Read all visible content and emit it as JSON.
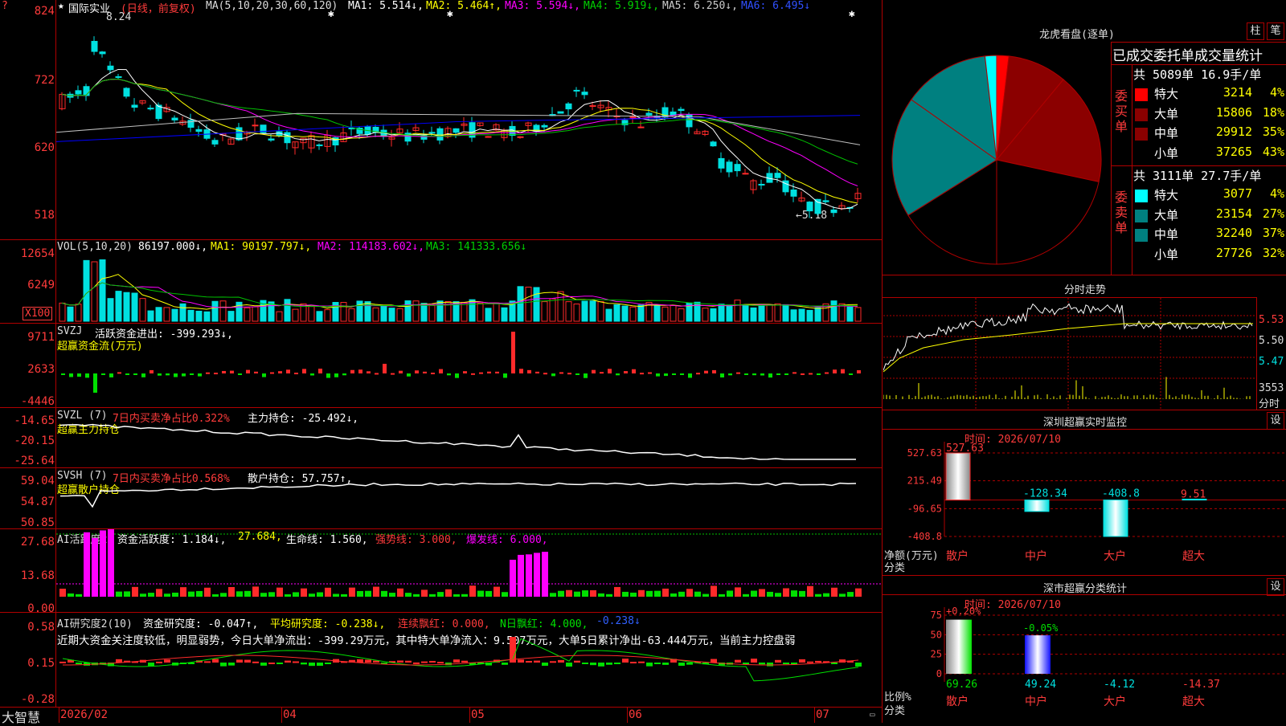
{
  "colors": {
    "up": "#ff2a2a",
    "down": "#00e0e0",
    "ma1": "#ffffff",
    "ma2": "#ffff00",
    "ma3": "#ff00ff",
    "ma4": "#00c000",
    "ma5": "#c0c0c0",
    "ma6": "#0000ff",
    "grid": "#b00000"
  },
  "kline": {
    "marker": "?",
    "star": "★",
    "name": "国际实业",
    "period": "(日线，前复权)",
    "ma_title": "MA(5,10,20,30,60,120)",
    "ma1": "MA1: 5.514↓,",
    "ma2": "MA2: 5.464↑,",
    "ma3": "MA3: 5.594↓,",
    "ma4": "MA4: 5.919↓,",
    "ma5": "MA5: 6.250↓,",
    "ma6": "MA6: 6.495↓",
    "y_ticks": [
      "824",
      "722",
      "620",
      "518"
    ],
    "high_label": "8.24",
    "low_label": "←5.18",
    "corner_mark": "✱"
  },
  "vol": {
    "title": "VOL(5,10,20)",
    "value": "86197.000↓,",
    "ma1": "MA1: 90197.797↓,",
    "ma2": "MA2: 114183.602↓,",
    "ma3": "MA3: 141333.656↓",
    "y_ticks": [
      "12654",
      "6249"
    ],
    "unit": "X100"
  },
  "svzj": {
    "title": "SVZJ",
    "name": "活跃资金进出: -399.293↓,",
    "sub": "超赢资金流(万元)",
    "y_ticks": [
      "9711",
      "2633",
      "-4446"
    ]
  },
  "svzl": {
    "title": "SVZL (7)",
    "ratio": "7日内买卖净占比0.322%",
    "hold": "主力持仓: -25.492↓,",
    "sub": "超赢主力持仓",
    "y_ticks": [
      "-14.65",
      "-20.15",
      "-25.64"
    ]
  },
  "svsh": {
    "title": "SVSH (7)",
    "ratio": "7日内买卖净占比0.568%",
    "hold": "散户持仓: 57.757↑,",
    "sub": "超赢散户持仓",
    "y_ticks": [
      "59.04",
      "54.87",
      "50.85"
    ]
  },
  "ai1": {
    "title": "AI活跃度2",
    "active": "资金活跃度: 1.184↓,",
    "val2": "27.684,",
    "life": "生命线: 1.560,",
    "strong": "强势线: 3.000,",
    "burst": "爆发线: 6.000,",
    "y_ticks": [
      "27.68",
      "13.68",
      "0.00"
    ]
  },
  "ai2": {
    "title": "AI研究度2(10)",
    "research": "资金研究度: -0.047↑,",
    "avg": "平均研究度: -0.238↓,",
    "cont": "连续飘红: 0.000,",
    "nday": "N日飘红: 4.000,",
    "neg": "-0.238↓",
    "comment": "近期大资金关注度较低，明显弱势，今日大单净流出：-399.29万元，其中特大单净流入：9.507万元，大单5日累计净出-63.444万元，当前主力控盘弱",
    "y_ticks": [
      "0.58",
      "0.15",
      "-0.28"
    ]
  },
  "xaxis": {
    "labels": [
      "2026/02",
      "04",
      "05",
      "06",
      "07"
    ]
  },
  "logo": "大智慧",
  "longhu": {
    "title": "龙虎看盘(逐单)",
    "btn1": "柱",
    "btn2": "笔",
    "header": "已成交委托单成交量统计",
    "buy_label": "委买单",
    "buy_total": "共 5089单 16.9手/单",
    "buy_rows": [
      {
        "name": "特大",
        "vol": "3214",
        "pct": "4%",
        "color": "#ff0000"
      },
      {
        "name": "大单",
        "vol": "15806",
        "pct": "18%",
        "color": "#8b0000"
      },
      {
        "name": "中单",
        "vol": "29912",
        "pct": "35%",
        "color": "#8b0000"
      },
      {
        "name": "小单",
        "vol": "37265",
        "pct": "43%",
        "color": "#000000"
      }
    ],
    "sell_label": "委卖单",
    "sell_total": "共 3111单 27.7手/单",
    "sell_rows": [
      {
        "name": "特大",
        "vol": "3077",
        "pct": "4%",
        "color": "#00ffff"
      },
      {
        "name": "大单",
        "vol": "23154",
        "pct": "27%",
        "color": "#008080"
      },
      {
        "name": "中单",
        "vol": "32240",
        "pct": "37%",
        "color": "#008080"
      },
      {
        "name": "小单",
        "vol": "27726",
        "pct": "32%",
        "color": "#000000"
      }
    ]
  },
  "fenshi": {
    "title": "分时走势",
    "prices": [
      "5.53",
      "5.50",
      "5.47"
    ],
    "vol": "3553",
    "vol_unit": "分时"
  },
  "sz_monitor": {
    "title": "深圳超赢实时监控",
    "btn": "设",
    "time": "时间: 2026/07/10",
    "y_ticks": [
      "527.63",
      "215.49",
      "-96.65",
      "-408.8"
    ],
    "ylabel": "净额(万元)",
    "xlabel": "分类",
    "bars": [
      {
        "name": "散户",
        "value": 527.63,
        "label": "527.63"
      },
      {
        "name": "中户",
        "value": -128.34,
        "label": "-128.34"
      },
      {
        "name": "大户",
        "value": -408.8,
        "label": "-408.8"
      },
      {
        "name": "超大",
        "value": 9.51,
        "label": "9.51"
      }
    ]
  },
  "sz_class": {
    "title": "深市超赢分类统计",
    "btn": "设",
    "time": "时间: 2026/07/10",
    "y_ticks": [
      "75",
      "50",
      "25",
      "0"
    ],
    "ylabel": "比例%",
    "xlabel": "分类",
    "top_labels": [
      "+0.20%",
      "-0.05%"
    ],
    "bars": [
      {
        "name": "散户",
        "value": 69.26,
        "label": "69.26"
      },
      {
        "name": "中户",
        "value": 49.24,
        "label": "49.24"
      },
      {
        "name": "大户",
        "value": -4.12,
        "label": "-4.12"
      },
      {
        "name": "超大",
        "value": -14.37,
        "label": "-14.37"
      }
    ]
  }
}
